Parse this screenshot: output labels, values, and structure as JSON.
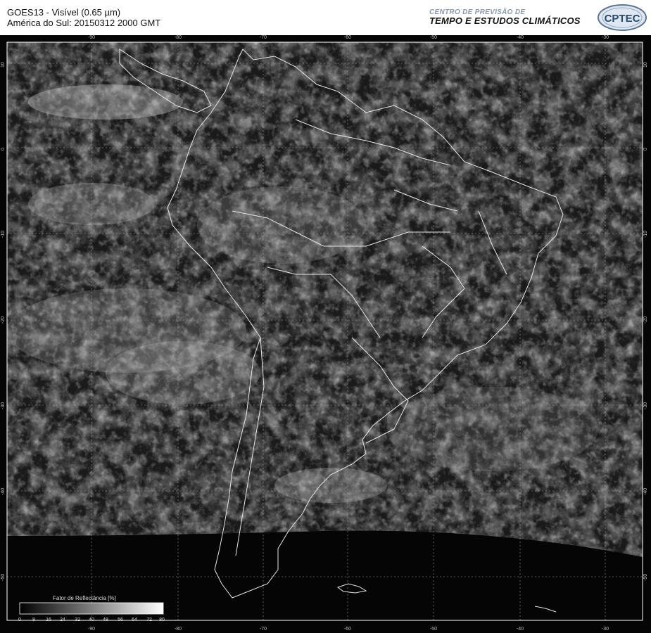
{
  "header": {
    "line1": "GOES13 - Visível (0.65 µm)",
    "line2": "América do Sul: 20150312 2000 GMT",
    "org_line1": "CENTRO DE PREVISÃO DE",
    "org_line2": "TEMPO E ESTUDOS CLIMÁTICOS",
    "logo_text": "CPTEC"
  },
  "map": {
    "lon_labels": [
      "-90",
      "-80",
      "-70",
      "-60",
      "-50",
      "-40",
      "-30"
    ],
    "lat_labels": [
      "10",
      "0",
      "-10",
      "-20",
      "-30",
      "-40",
      "-50"
    ],
    "colors": {
      "background": "#050505",
      "borders": "#e8e8e8",
      "grid": "#9a9a9a"
    }
  },
  "legend": {
    "title": "Fator de Reflectância [%]",
    "ticks": [
      "0",
      "8",
      "16",
      "24",
      "32",
      "40",
      "48",
      "56",
      "64",
      "72",
      "80"
    ]
  }
}
